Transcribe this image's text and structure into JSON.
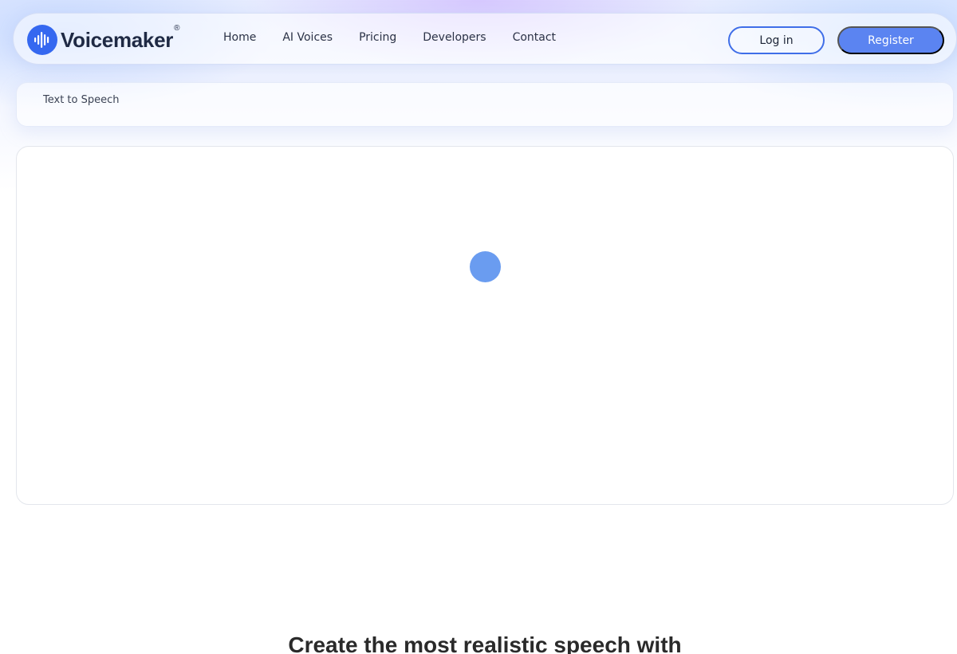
{
  "brand": {
    "name": "Voicemaker",
    "registered_mark": "®",
    "accent_color": "#3568f0"
  },
  "nav": {
    "links": [
      {
        "label": "Home"
      },
      {
        "label": "AI Voices"
      },
      {
        "label": "Pricing"
      },
      {
        "label": "Developers"
      },
      {
        "label": "Contact"
      }
    ],
    "login_label": "Log in",
    "register_label": "Register"
  },
  "tabs": [
    {
      "label": "Text to Speech"
    }
  ],
  "main": {
    "loading_indicator": "spinner"
  },
  "hero": {
    "heading": "Create the most realistic speech with"
  },
  "colors": {
    "primary_button": "#5b84f1",
    "outline_button_border": "#3f6ee8",
    "spinner": "#6a9cf0"
  }
}
